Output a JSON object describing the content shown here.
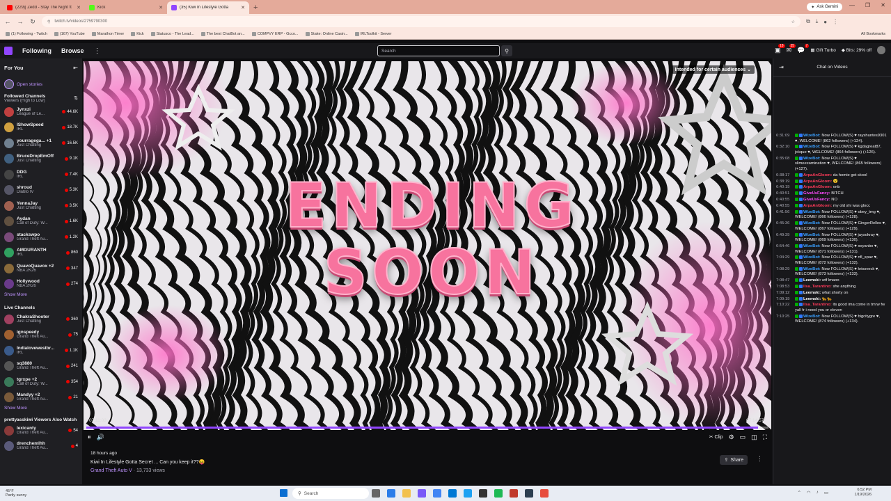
{
  "browser": {
    "tabs": [
      {
        "title": "(229)| Zedd - Stay The Night ft",
        "fav_color": "#ff0000",
        "active": false
      },
      {
        "title": "Kick",
        "fav_color": "#53fc18",
        "active": false
      },
      {
        "title": "(35) Kiwi In Lifestyle Gotta",
        "fav_color": "#9146ff",
        "active": true
      }
    ],
    "ask_gemini": "Ask Gemini",
    "url": "twitch.tv/videos/2759790300",
    "bookmarks": [
      "(1) Following - Twitch",
      "(167) YouTube",
      "Marathon Timer",
      "Kick",
      "Statusco - The Lead...",
      "The best ChatBot an...",
      "COMPVY ERP - Gcco...",
      "Stake: Online Casin...",
      "IRLToolkit - Server"
    ],
    "all_bookmarks": "All Bookmarks"
  },
  "topnav": {
    "following": "Following",
    "browse": "Browse",
    "search_placeholder": "Search",
    "notif_counts": [
      "18",
      "35",
      "7"
    ],
    "gift_turbo": "Gift Turbo",
    "bits": "Bits: 29% off"
  },
  "sidebar": {
    "for_you": "For You",
    "open_stories": "Open stories",
    "followed_title": "Followed Channels",
    "followed_sort": "Viewers (High to Low)",
    "followed": [
      {
        "name": "Jynxzi",
        "game": "League of Le...",
        "viewers": "44.6K",
        "color": "#c04040"
      },
      {
        "name": "IShowSpeed",
        "game": "IRL",
        "viewers": "18.7K",
        "color": "#d0a040"
      },
      {
        "name": "yourragega... +1",
        "game": "Just Chatting",
        "viewers": "16.5K",
        "color": "#708090"
      },
      {
        "name": "BruceDropEmOff",
        "game": "Just Chatting",
        "viewers": "9.1K",
        "color": "#406080"
      },
      {
        "name": "DDG",
        "game": "IRL",
        "viewers": "7.4K",
        "color": "#444"
      },
      {
        "name": "shroud",
        "game": "Diablo IV",
        "viewers": "5.3K",
        "color": "#556"
      },
      {
        "name": "YennaJay",
        "game": "Just Chatting",
        "viewers": "3.5K",
        "color": "#a06050"
      },
      {
        "name": "Aydan",
        "game": "Call of Duty: W...",
        "viewers": "1.6K",
        "color": "#605040"
      },
      {
        "name": "stackswpo",
        "game": "Grand Theft Au...",
        "viewers": "1.2K",
        "color": "#7a4a7a"
      },
      {
        "name": "AMOURANTH",
        "game": "IRL",
        "viewers": "860",
        "color": "#30a060"
      },
      {
        "name": "QuavoQuavox +2",
        "game": "NBA 2K26",
        "viewers": "347",
        "color": "#8a6a3a"
      },
      {
        "name": "Hollywood",
        "game": "NBA 2K26",
        "viewers": "274",
        "color": "#6a3a8a"
      }
    ],
    "show_more": "Show More",
    "live_title": "Live Channels",
    "live": [
      {
        "name": "ChakraShooter",
        "game": "Just Chatting",
        "viewers": "360",
        "color": "#a04060"
      },
      {
        "name": "ignspeedy",
        "game": "Grand Theft Au...",
        "viewers": "75",
        "color": "#a06030"
      },
      {
        "name": "Indialovewestbr...",
        "game": "IRL",
        "viewers": "1.1K",
        "color": "#3a5a8a"
      },
      {
        "name": "sq3880",
        "game": "Grand Theft Au...",
        "viewers": "241",
        "color": "#555"
      },
      {
        "name": "tgrxpe +2",
        "game": "Call of Duty: W...",
        "viewers": "354",
        "color": "#3a7a5a"
      },
      {
        "name": "Mandyy +2",
        "game": "Grand Theft Au...",
        "viewers": "21",
        "color": "#7a5a3a"
      }
    ],
    "show_more_2": "Show More",
    "also_watch": "prettyasskiwi Viewers Also Watch",
    "also": [
      {
        "name": "lexicanty",
        "game": "Grand Theft Au...",
        "viewers": "54",
        "color": "#8a3a3a"
      },
      {
        "name": "drenchemlhh",
        "game": "Grand Theft Au...",
        "viewers": "4",
        "color": "#5a5a7a"
      }
    ]
  },
  "player": {
    "audience": "Intended for certain audiences",
    "line1": "ENDING",
    "line2": "SOON",
    "time_start": "07:11:03",
    "time_end": "07:14:57",
    "progress": 0.985,
    "clip": "Clip"
  },
  "info": {
    "ago": "18 hours ago",
    "title": "Kiwi In Lifestyle Gotta Secret ... Can you keep it??😝",
    "category": "Grand Theft Auto V",
    "views": "· 13,733 views",
    "share": "Share"
  },
  "chat": {
    "header": "Chat on Videos",
    "messages": [
      {
        "ts": "6:31:09",
        "user": "WizeBot:",
        "ucolor": "#3aa0ff",
        "text": "Now FOLLOW(S) ♥ rayshuntes9301 ♥, WELCOME! (862 followers) (+124)."
      },
      {
        "ts": "6:32:10",
        "user": "WizeBot:",
        "ucolor": "#3aa0ff",
        "text": "Now FOLLOW(S) ♥ kgdagreat87, jckque ♥, WELCOME! (864 followers) (+126)."
      },
      {
        "ts": "6:35:08",
        "user": "WizeBot:",
        "ucolor": "#3aa0ff",
        "text": "Now FOLLOW(S) ♥ slimeexamination ♥, WELCOME! (865 followers) (+127)."
      },
      {
        "ts": "6:38:17",
        "user": "ArpaAnGloom:",
        "ucolor": "#ff3a5a",
        "text": "da homie got skool"
      },
      {
        "ts": "6:38:19",
        "user": "ArpaAnGloom:",
        "ucolor": "#ff3a5a",
        "text": "😮"
      },
      {
        "ts": "6:40:19",
        "user": "ArpaAnGloom:",
        "ucolor": "#ff3a5a",
        "text": "onb"
      },
      {
        "ts": "6:40:51",
        "user": "GiveUsFancy:",
        "ucolor": "#ff4aff",
        "text": "BITCH"
      },
      {
        "ts": "6:40:55",
        "user": "GiveUsFancy:",
        "ucolor": "#ff4aff",
        "text": "NO"
      },
      {
        "ts": "6:40:55",
        "user": "ArpaAnGloom:",
        "ucolor": "#ff3a5a",
        "text": "my old shi was glocc"
      },
      {
        "ts": "6:41:56",
        "user": "WizeBot:",
        "ucolor": "#3aa0ff",
        "text": "Now FOLLOW(S) ♥ obey_tmg ♥, WELCOME! (866 followers) (+128)."
      },
      {
        "ts": "6:45:36",
        "user": "WizeBot:",
        "ucolor": "#3aa0ff",
        "text": "Now FOLLOW(S) ♥ GingerRelles ♥, WELCOME! (867 followers) (+129)."
      },
      {
        "ts": "6:49:39",
        "user": "WizeBot:",
        "ucolor": "#3aa0ff",
        "text": "Now FOLLOW(S) ♥ jaysokray ♥, WELCOME! (869 followers) (+130)."
      },
      {
        "ts": "6:54:46",
        "user": "WizeBot:",
        "ucolor": "#3aa0ff",
        "text": "Now FOLLOW(S) ♥ xoyanbo ♥, WELCOME! (871 followers) (+131)."
      },
      {
        "ts": "7:04:29",
        "user": "WizeBot:",
        "ucolor": "#3aa0ff",
        "text": "Now FOLLOW(S) ♥ nfl_spaz ♥, WELCOME! (872 followers) (+132)."
      },
      {
        "ts": "7:08:29",
        "user": "WizeBot:",
        "ucolor": "#3aa0ff",
        "text": "Now FOLLOW(S) ♥ krissveck ♥, WELCOME! (873 followers) (+133)."
      },
      {
        "ts": "7:08:47",
        "user": "Leemski:",
        "ucolor": "#ffffff",
        "text": "wtf lmaoo"
      },
      {
        "ts": "7:08:53",
        "user": "Ilsa_Tarantino:",
        "ucolor": "#ff3a5a",
        "text": "she anything"
      },
      {
        "ts": "7:09:12",
        "user": "Leemski:",
        "ucolor": "#ffffff",
        "text": "what shorty on"
      },
      {
        "ts": "7:09:19",
        "user": "Leemski:",
        "ucolor": "#ffffff",
        "text": "🐆🐆"
      },
      {
        "ts": "7:10:22",
        "user": "Ilsa_Tarantino:",
        "ucolor": "#ff3a5a",
        "text": "its good ima come in tmrw fw yall fr i need you or eleven"
      },
      {
        "ts": "7:10:25",
        "user": "WizeBot:",
        "ucolor": "#3aa0ff",
        "text": "Now FOLLOW(S) ♥ bigcitygre ♥, WELCOME! (874 followers) (+134)."
      }
    ]
  },
  "taskbar": {
    "weather_temp": "45°F",
    "weather_desc": "Partly sunny",
    "search": "Search",
    "time": "6:52 PM",
    "date": "1/19/2026"
  }
}
